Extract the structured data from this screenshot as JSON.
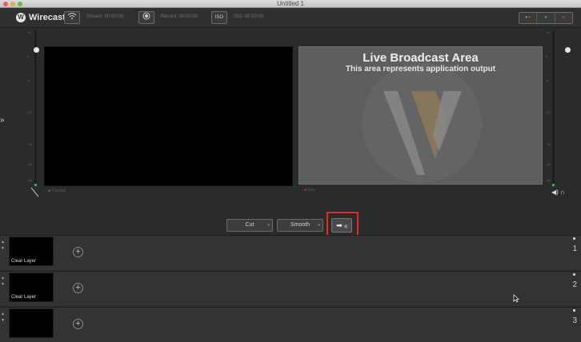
{
  "window": {
    "title": "Untitled 1"
  },
  "toolbar": {
    "app_name": "Wirecast",
    "stream_label": "Stream: 00:00:00",
    "record_label": "Record: 00:00:00",
    "iso_label": "ISO: 00:00:00",
    "iso_button": "ISO"
  },
  "meters": {
    "ticks": [
      "+6",
      "0",
      "-6",
      "-12",
      "-18",
      "-24",
      "-36"
    ]
  },
  "preview": {
    "label": "Preview"
  },
  "live": {
    "title": "Live Broadcast Area",
    "subtitle": "This area represents application output",
    "label": "Live"
  },
  "transitions": {
    "cut": "Cut",
    "smooth": "Smooth",
    "go_symbol": "➡",
    "go_small": "o"
  },
  "layers": [
    {
      "thumb_label": "Clear Layer",
      "number": "1"
    },
    {
      "thumb_label": "Clear Layer",
      "number": "2"
    },
    {
      "thumb_label": "",
      "number": "3"
    }
  ],
  "colors": {
    "highlight": "#d9302c",
    "live_bg": "#5e5e5e",
    "meter_green": "#3cb043"
  },
  "icons": [
    "wifi-icon",
    "record-icon",
    "iso-icon",
    "expand-icon",
    "speaker-icon",
    "headphones-icon",
    "add-icon",
    "cursor-icon"
  ]
}
